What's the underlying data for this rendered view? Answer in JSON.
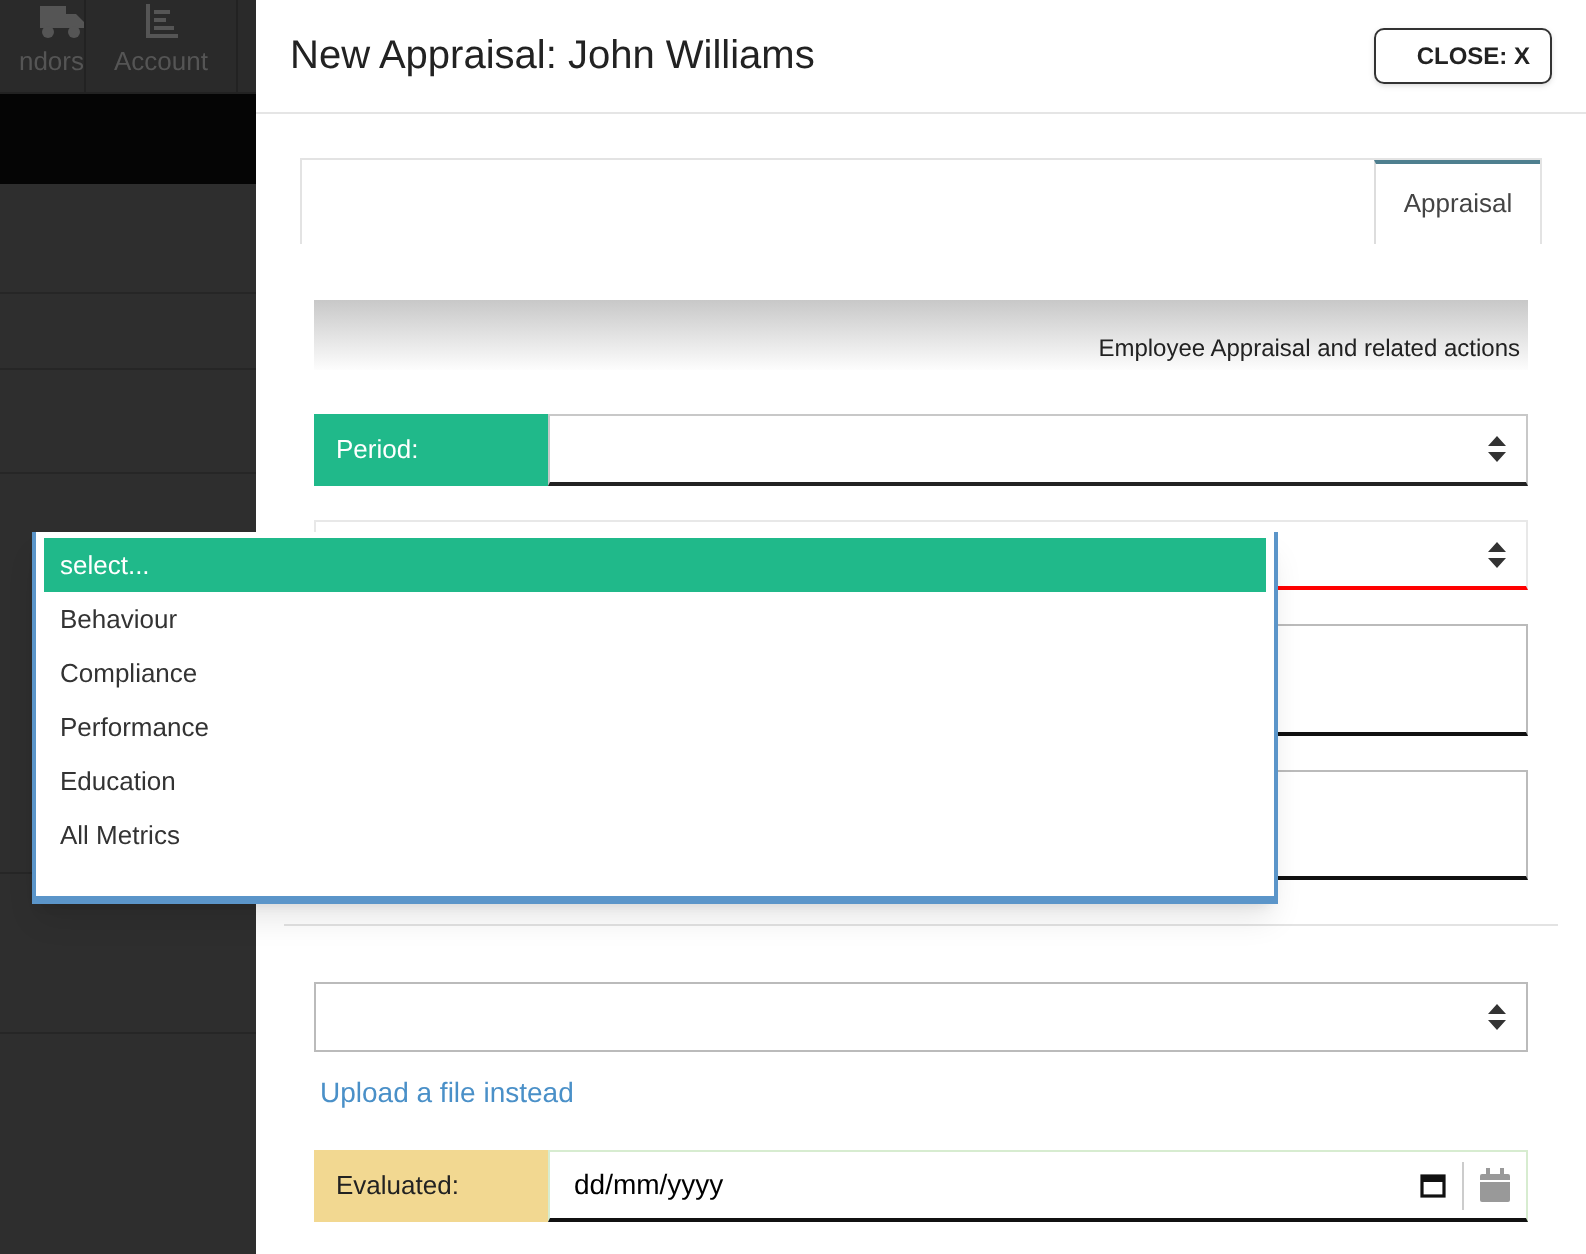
{
  "nav": [
    {
      "label": "ndors"
    },
    {
      "label": "Account"
    }
  ],
  "modal": {
    "title": "New Appraisal: John Williams",
    "close_label": "CLOSE: X",
    "tabs": [
      {
        "label": "Appraisal",
        "selected": true
      }
    ],
    "banner": "Employee Appraisal and related actions",
    "period": {
      "label": "Period:"
    },
    "metric_select": {
      "invalid": true
    },
    "upload_link": "Upload a file instead",
    "evaluated": {
      "label": "Evaluated:",
      "placeholder": "dd/mm/yyyy"
    }
  },
  "dropdown": {
    "options": [
      {
        "label": "select...",
        "selected": true
      },
      {
        "label": "Behaviour",
        "selected": false
      },
      {
        "label": "Compliance",
        "selected": false
      },
      {
        "label": "Performance",
        "selected": false
      },
      {
        "label": "Education",
        "selected": false
      },
      {
        "label": "All Metrics",
        "selected": false
      }
    ]
  }
}
